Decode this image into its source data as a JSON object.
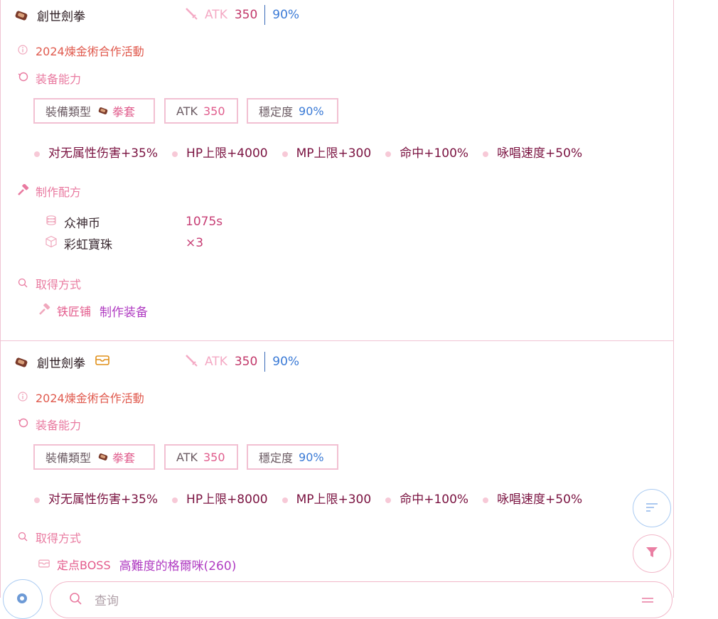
{
  "colors": {
    "accent_pink": "#e97aa0",
    "deep_pink": "#c2386a",
    "blue": "#3a7ad6",
    "event_red": "#e05a4e",
    "purple_link": "#b03cc2"
  },
  "cards": [
    {
      "name": "創世劍拳",
      "atk_label": "ATK",
      "atk_value": "350",
      "stability": "90%",
      "event": "2024煉金術合作活動",
      "ability_title": "装备能力",
      "type_label": "裝備類型",
      "type_value": "拳套",
      "box_atk_label": "ATK",
      "box_atk_value": "350",
      "box_stab_label": "穩定度",
      "box_stab_value": "90%",
      "stats": [
        "对无属性伤害+35%",
        "HP上限+4000",
        "MP上限+300",
        "命中+100%",
        "咏唱速度+50%"
      ],
      "recipe_title": "制作配方",
      "materials": [
        {
          "icon": "coins-icon",
          "name": "众神币",
          "value": "1075s"
        },
        {
          "icon": "cube-icon",
          "name": "彩虹寶珠",
          "value": "×3"
        }
      ],
      "source_title": "取得方式",
      "source_label": "铁匠铺",
      "source_link": "制作装备"
    },
    {
      "name": "創世劍拳",
      "atk_label": "ATK",
      "atk_value": "350",
      "stability": "90%",
      "event": "2024煉金術合作活動",
      "ability_title": "装备能力",
      "type_label": "裝備類型",
      "type_value": "拳套",
      "box_atk_label": "ATK",
      "box_atk_value": "350",
      "box_stab_label": "穩定度",
      "box_stab_value": "90%",
      "stats": [
        "对无属性伤害+35%",
        "HP上限+8000",
        "MP上限+300",
        "命中+100%",
        "咏唱速度+50%"
      ],
      "source_title": "取得方式",
      "source_label": "定点BOSS",
      "source_link": "高難度的格爾咪(260)"
    }
  ],
  "search": {
    "placeholder": "查询"
  }
}
